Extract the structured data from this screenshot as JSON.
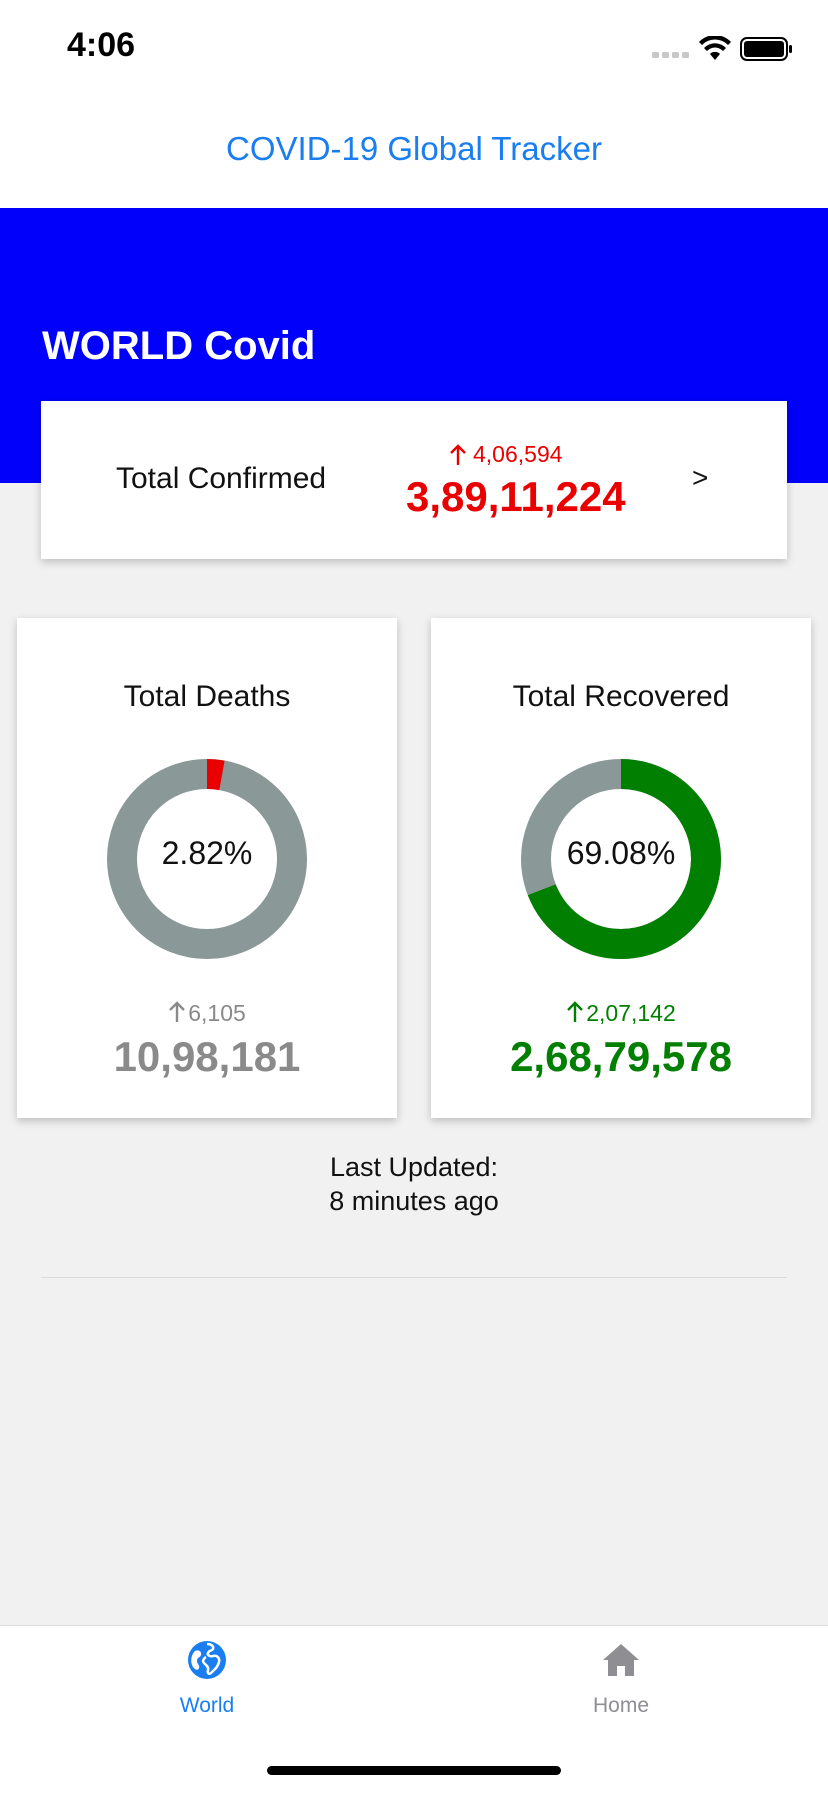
{
  "status_bar": {
    "time": "4:06"
  },
  "nav": {
    "title": "COVID-19 Global Tracker"
  },
  "header": {
    "title": "WORLD Covid"
  },
  "confirmed": {
    "label": "Total Confirmed",
    "delta": "4,06,594",
    "total": "3,89,11,224",
    "color": "#e90000"
  },
  "deaths": {
    "label": "Total Deaths",
    "percent_label": "2.82%",
    "percent_value": 2.82,
    "delta": "6,105",
    "total": "10,98,181",
    "color": "#8a8a8a",
    "ring_color": "#e90000",
    "track_color": "#8a9898"
  },
  "recovered": {
    "label": "Total Recovered",
    "percent_label": "69.08%",
    "percent_value": 69.08,
    "delta": "2,07,142",
    "total": "2,68,79,578",
    "color": "#007f00",
    "ring_color": "#007f00",
    "track_color": "#8a9898"
  },
  "last_updated": {
    "label": "Last Updated:",
    "value": "8 minutes ago"
  },
  "tabs": [
    {
      "label": "World",
      "icon": "globe-icon",
      "active": true
    },
    {
      "label": "Home",
      "icon": "home-icon",
      "active": false
    }
  ],
  "colors": {
    "accent": "#1a7ef0",
    "header_blue": "#0000fb",
    "inactive_tab": "#8e8e93"
  }
}
